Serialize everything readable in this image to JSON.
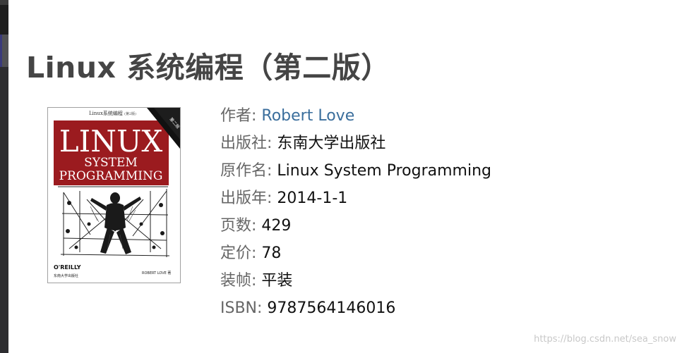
{
  "title": "Linux 系统编程（第二版）",
  "cover": {
    "small_title": "Linux系统编程",
    "small_edition": "(第2版)",
    "big_title_line1": "LINUX",
    "big_title_line2": "SYSTEM",
    "big_title_line3": "PROGRAMMING",
    "banner_text": "第二版",
    "publisher_logo": "O'REILLY",
    "publisher_cn": "东南大学出版社",
    "author": "ROBERT LOVE 著",
    "accent_color": "#9b1b1f"
  },
  "info": [
    {
      "label": "作者",
      "value": "Robert Love",
      "link": true
    },
    {
      "label": "出版社",
      "value": "东南大学出版社",
      "link": false
    },
    {
      "label": "原作名",
      "value": "Linux System Programming",
      "link": false
    },
    {
      "label": "出版年",
      "value": "2014-1-1",
      "link": false
    },
    {
      "label": "页数",
      "value": "429",
      "link": false
    },
    {
      "label": "定价",
      "value": "78",
      "link": false
    },
    {
      "label": "装帧",
      "value": "平装",
      "link": false
    },
    {
      "label": "ISBN",
      "value": "9787564146016",
      "link": false
    }
  ],
  "separator": ":",
  "watermark": "https://blog.csdn.net/sea_snow"
}
